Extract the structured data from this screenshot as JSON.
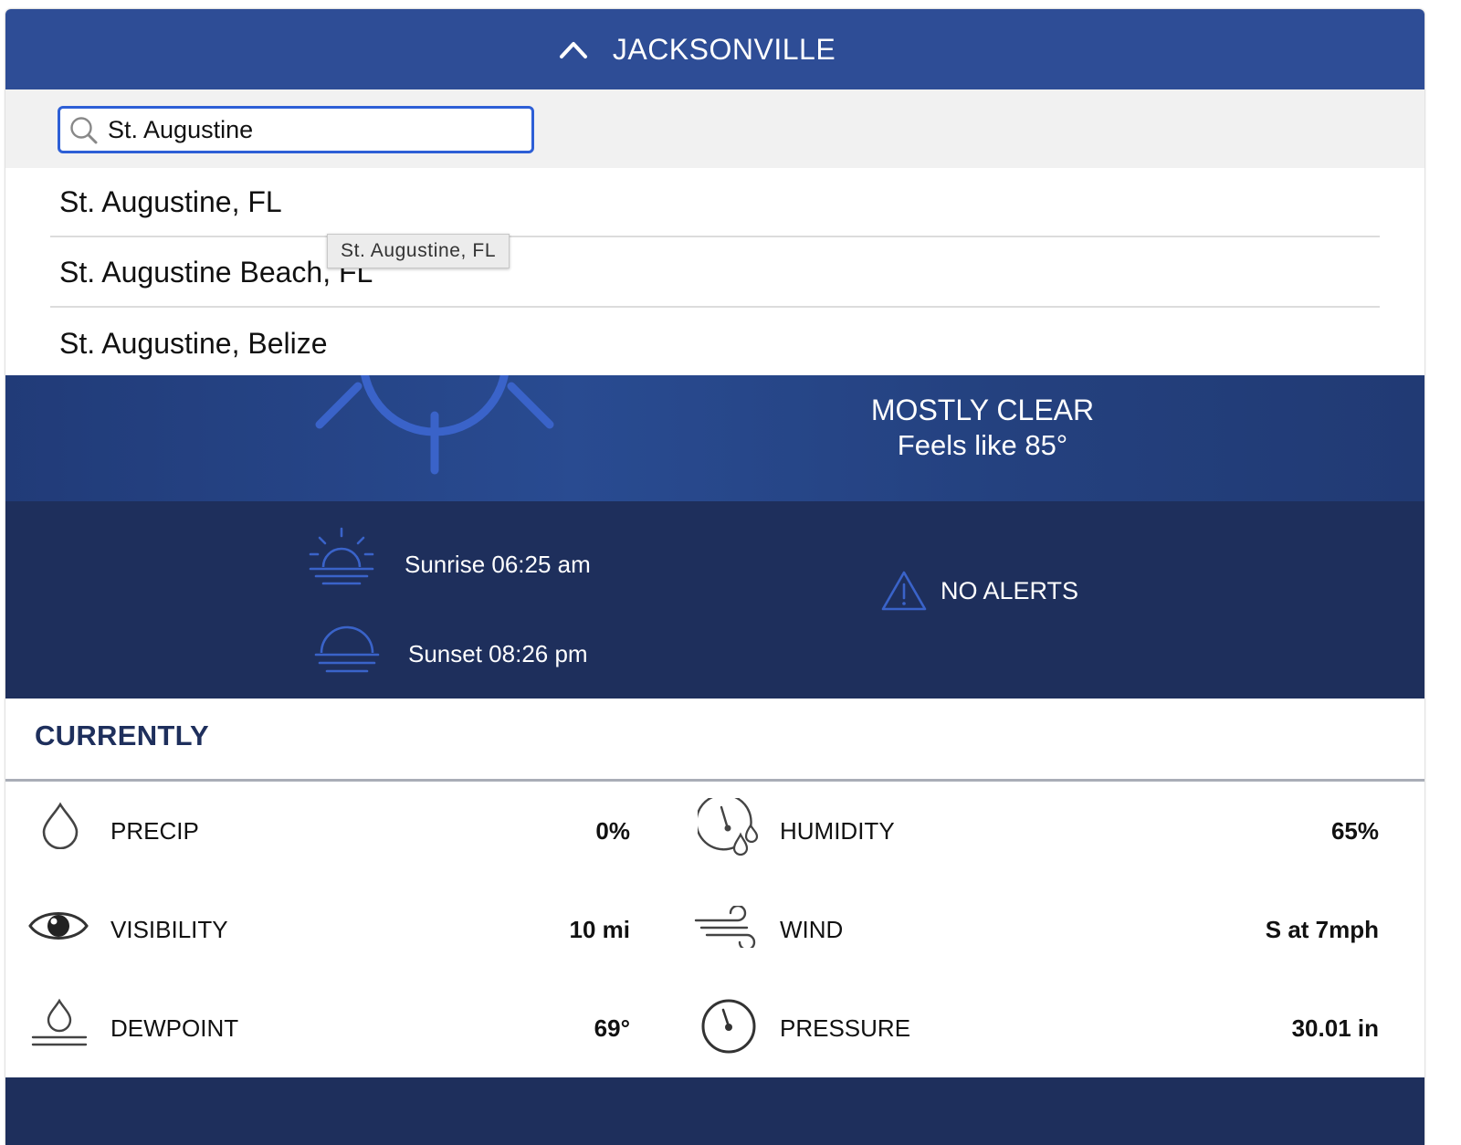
{
  "header": {
    "title": "JACKSONVILLE",
    "toggle_icon": "chevron-up-icon"
  },
  "search": {
    "value": "St. Augustine",
    "icon": "search-icon"
  },
  "dropdown": {
    "items": [
      {
        "label": "St. Augustine, FL"
      },
      {
        "label": "St. Augustine Beach, FL"
      },
      {
        "label": "St. Augustine, Belize"
      }
    ],
    "tooltip": "St. Augustine, FL"
  },
  "condition": {
    "icon": "sun-icon",
    "description": "MOSTLY CLEAR",
    "feels_like": "Feels like 85°"
  },
  "sun_times": {
    "sunrise": "Sunrise 06:25 am",
    "sunset": "Sunset 08:26 pm"
  },
  "alerts": {
    "label": "NO ALERTS",
    "icon": "warning-icon"
  },
  "currently": {
    "title": "CURRENTLY",
    "metrics": [
      {
        "label": "PRECIP",
        "value": "0%",
        "icon": "droplet-icon"
      },
      {
        "label": "HUMIDITY",
        "value": "65%",
        "icon": "humidity-gauge-icon"
      },
      {
        "label": "VISIBILITY",
        "value": "10 mi",
        "icon": "eye-icon"
      },
      {
        "label": "WIND",
        "value": "S at 7mph",
        "icon": "wind-icon"
      },
      {
        "label": "DEWPOINT",
        "value": "69°",
        "icon": "dewpoint-icon"
      },
      {
        "label": "PRESSURE",
        "value": "30.01 in",
        "icon": "pressure-gauge-icon"
      }
    ]
  },
  "colors": {
    "header_bg": "#2e4d96",
    "condition_bg": "#24417f",
    "dark_band": "#1e2f5c",
    "search_border": "#2d5fd6",
    "accent_icon": "#3a63c9"
  }
}
